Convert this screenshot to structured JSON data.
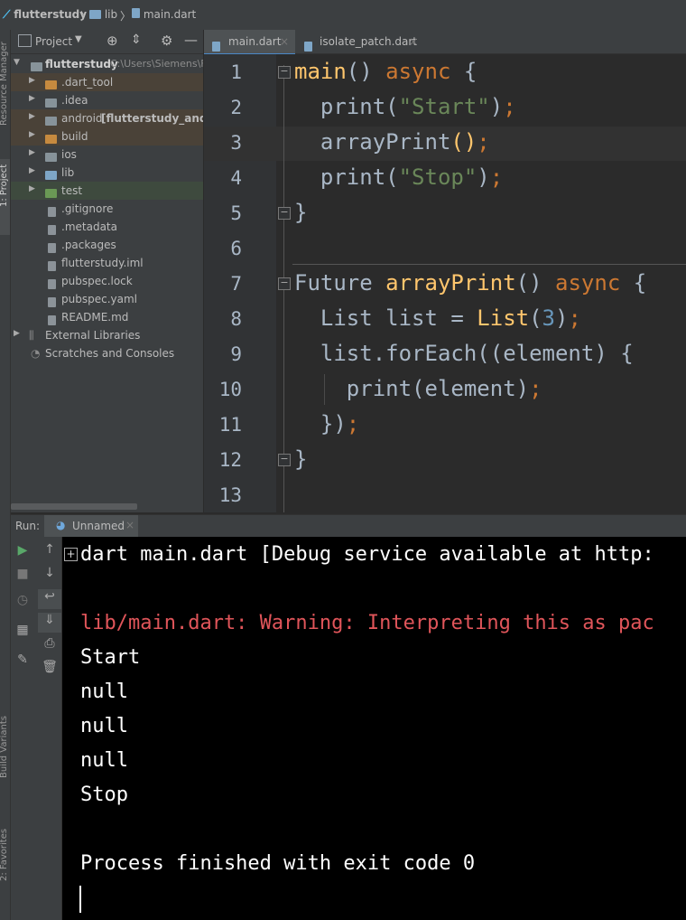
{
  "breadcrumb": {
    "project": "flutterstudy",
    "folder": "lib",
    "file": "main.dart"
  },
  "side_strip": {
    "top_label": "Resource Manager",
    "project_label": "1: Project",
    "variants_label": "Build Variants",
    "favorites_label": "2: Favorites"
  },
  "project_panel": {
    "view_label": "Project",
    "root": {
      "name": "flutterstudy",
      "path": "C:\\Users\\Siemens\\F"
    },
    "items": [
      {
        "label": ".dart_tool",
        "type": "folder-orange"
      },
      {
        "label": ".idea",
        "type": "folder"
      },
      {
        "label": "android",
        "extra": "[flutterstudy_android]",
        "type": "folder"
      },
      {
        "label": "build",
        "type": "folder-orange"
      },
      {
        "label": "ios",
        "type": "folder"
      },
      {
        "label": "lib",
        "type": "folder-blue"
      },
      {
        "label": "test",
        "type": "folder-green"
      },
      {
        "label": ".gitignore",
        "type": "file"
      },
      {
        "label": ".metadata",
        "type": "file"
      },
      {
        "label": ".packages",
        "type": "file"
      },
      {
        "label": "flutterstudy.iml",
        "type": "file"
      },
      {
        "label": "pubspec.lock",
        "type": "file"
      },
      {
        "label": "pubspec.yaml",
        "type": "file"
      },
      {
        "label": "README.md",
        "type": "file"
      }
    ],
    "external_libraries": "External Libraries",
    "scratches": "Scratches and Consoles"
  },
  "tabs": [
    {
      "label": "main.dart",
      "active": true
    },
    {
      "label": "isolate_patch.dart",
      "active": false
    }
  ],
  "editor": {
    "line_numbers": [
      "1",
      "2",
      "3",
      "4",
      "5",
      "6",
      "7",
      "8",
      "9",
      "10",
      "11",
      "12",
      "13"
    ],
    "lines": [
      [
        {
          "t": "main",
          "c": "fn"
        },
        {
          "t": "() ",
          "c": ""
        },
        {
          "t": "async",
          "c": "kw"
        },
        {
          "t": " {",
          "c": ""
        }
      ],
      [
        {
          "t": "  print(",
          "c": ""
        },
        {
          "t": "\"Start\"",
          "c": "str"
        },
        {
          "t": ")",
          "c": ""
        },
        {
          "t": ";",
          "c": "kw"
        }
      ],
      [
        {
          "t": "  arrayPrint",
          "c": ""
        },
        {
          "t": "()",
          "c": "fn"
        },
        {
          "t": ";",
          "c": "kw"
        }
      ],
      [
        {
          "t": "  print(",
          "c": ""
        },
        {
          "t": "\"Stop\"",
          "c": "str"
        },
        {
          "t": ")",
          "c": ""
        },
        {
          "t": ";",
          "c": "kw"
        }
      ],
      [
        {
          "t": "}",
          "c": ""
        }
      ],
      [],
      [
        {
          "t": "Future ",
          "c": ""
        },
        {
          "t": "arrayPrint",
          "c": "fn"
        },
        {
          "t": "() ",
          "c": ""
        },
        {
          "t": "async",
          "c": "kw"
        },
        {
          "t": " {",
          "c": ""
        }
      ],
      [
        {
          "t": "  List list = ",
          "c": ""
        },
        {
          "t": "List",
          "c": "fn"
        },
        {
          "t": "(",
          "c": ""
        },
        {
          "t": "3",
          "c": "num"
        },
        {
          "t": ")",
          "c": ""
        },
        {
          "t": ";",
          "c": "kw"
        }
      ],
      [
        {
          "t": "  list.forEach((element) {",
          "c": ""
        }
      ],
      [
        {
          "t": "    print(element)",
          "c": ""
        },
        {
          "t": ";",
          "c": "kw"
        }
      ],
      [
        {
          "t": "  })",
          "c": ""
        },
        {
          "t": ";",
          "c": "kw"
        }
      ],
      [
        {
          "t": "}",
          "c": ""
        }
      ],
      []
    ]
  },
  "run": {
    "label": "Run:",
    "config_tab": "Unnamed",
    "console_lines": [
      {
        "text": "dart main.dart [Debug service available at http:",
        "color": "#ffffff"
      },
      {
        "text": "",
        "color": "#ffffff"
      },
      {
        "text": "lib/main.dart: Warning: Interpreting this as pac",
        "color": "#e0555a"
      },
      {
        "text": "Start",
        "color": "#ffffff"
      },
      {
        "text": "null",
        "color": "#ffffff"
      },
      {
        "text": "null",
        "color": "#ffffff"
      },
      {
        "text": "null",
        "color": "#ffffff"
      },
      {
        "text": "Stop",
        "color": "#ffffff"
      },
      {
        "text": "",
        "color": "#ffffff"
      },
      {
        "text": "Process finished with exit code 0",
        "color": "#ffffff"
      }
    ]
  },
  "colors": {
    "keyword": "#cc7832",
    "function": "#ffc66d",
    "string": "#6a8759",
    "number": "#6897bb",
    "warning": "#e0555a"
  }
}
